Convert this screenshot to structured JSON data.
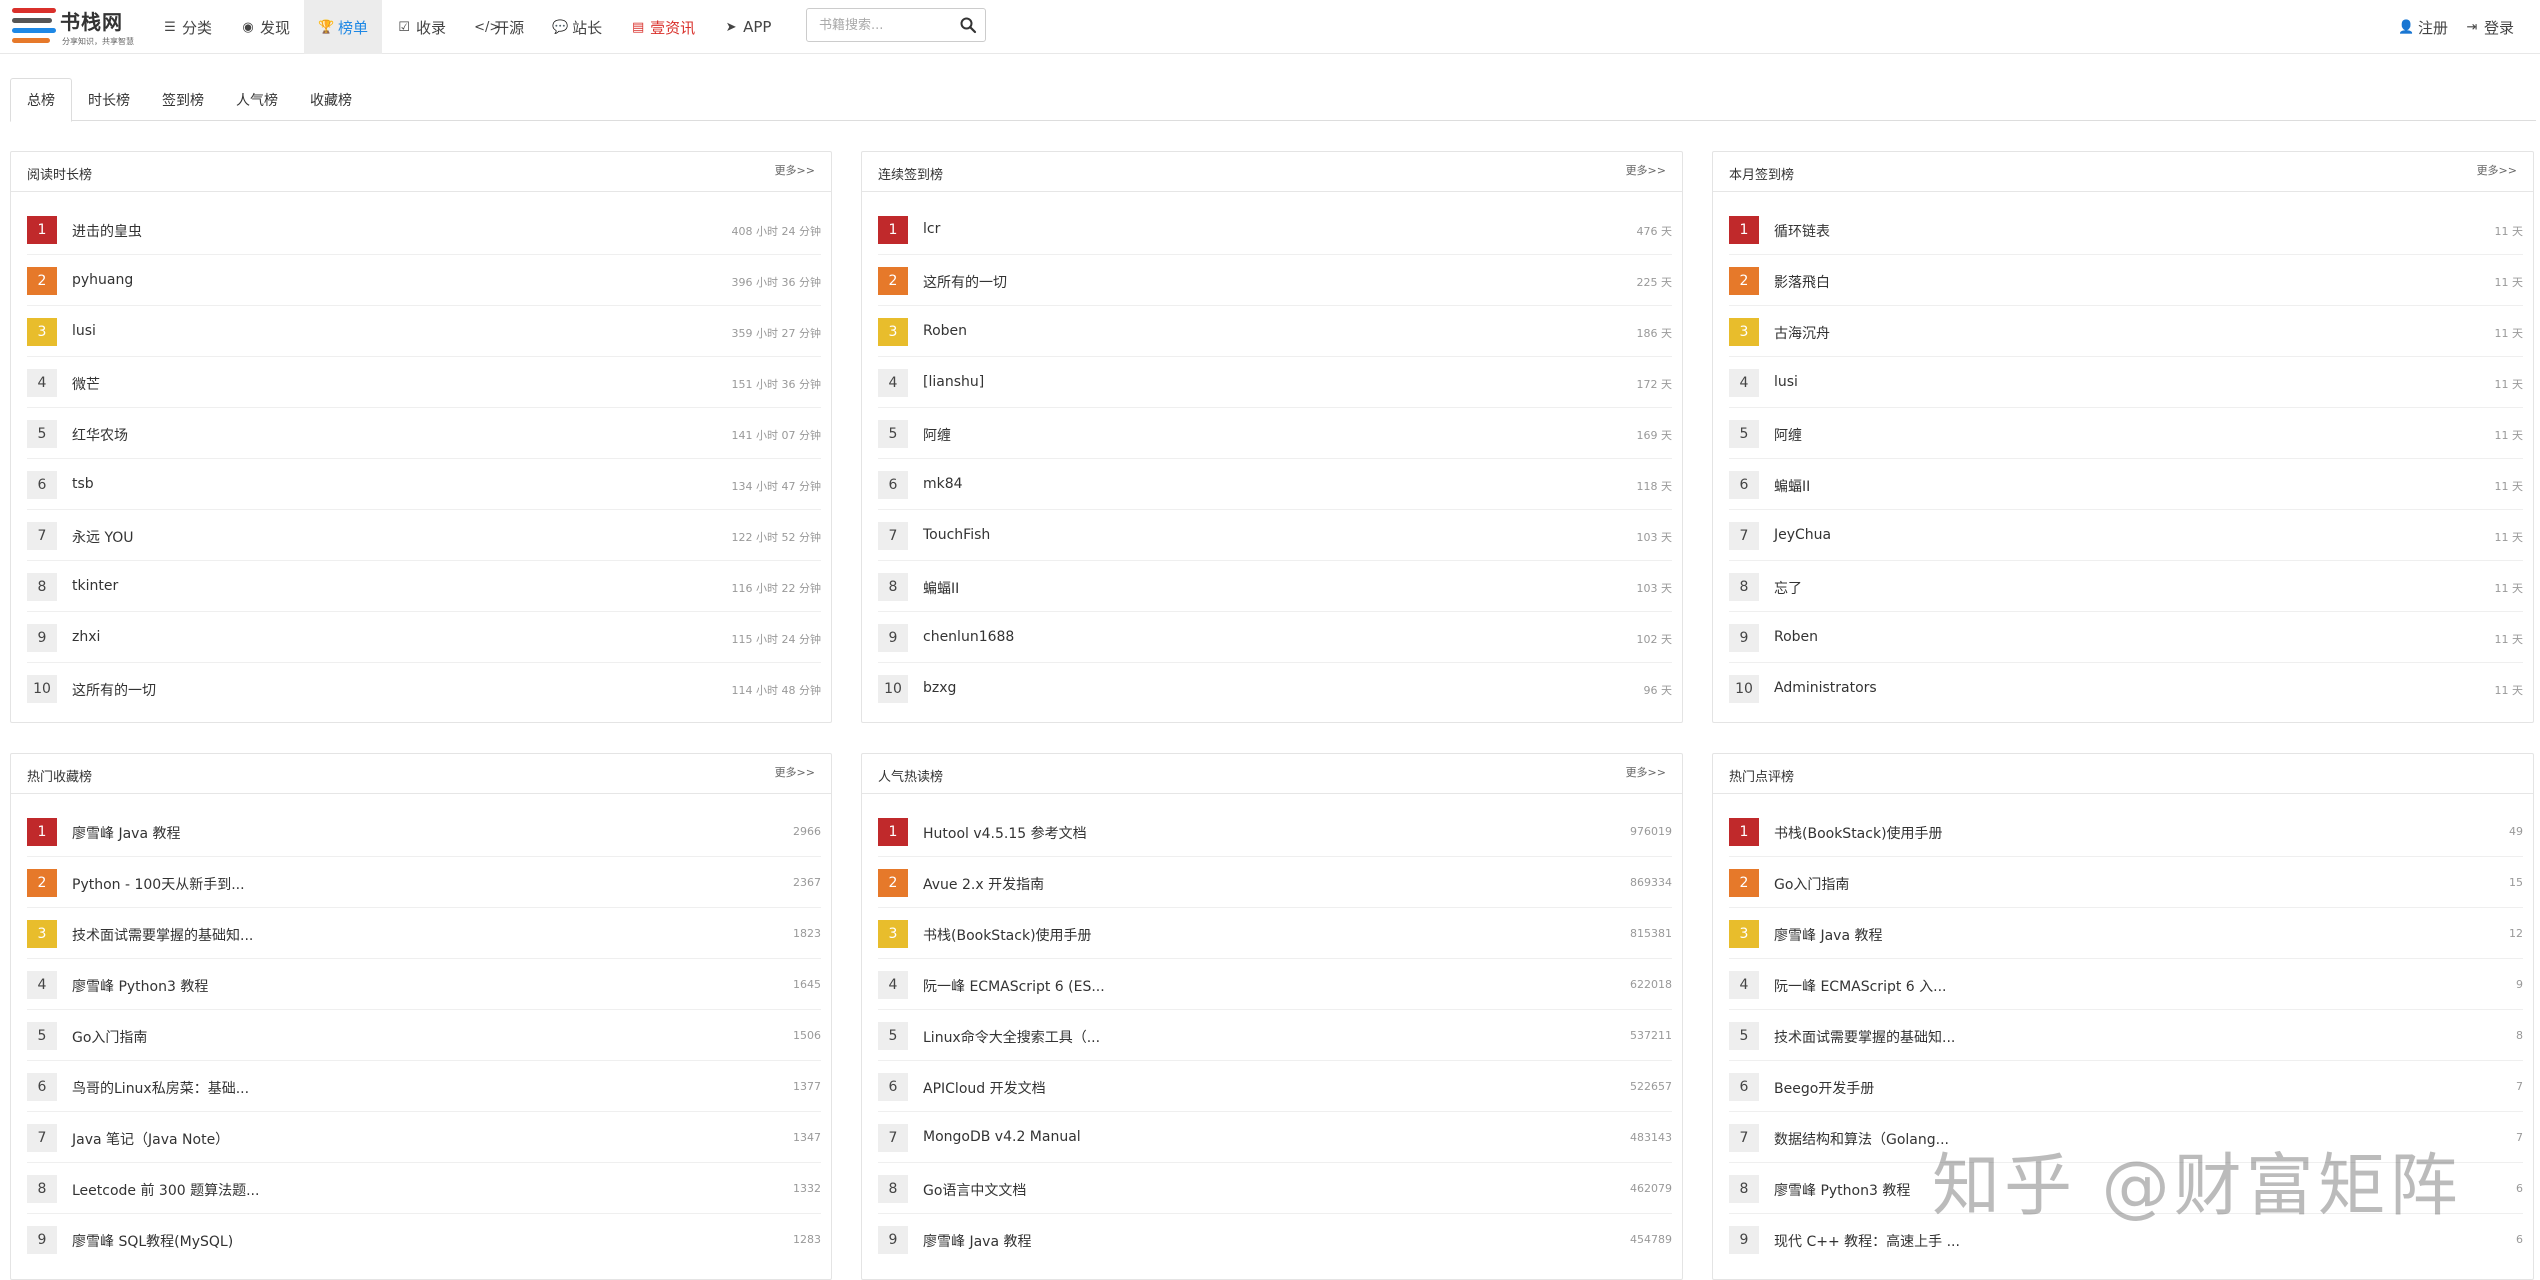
{
  "brand": {
    "title": "书栈网",
    "slogan": "分享知识，共享智慧",
    "colors": [
      "#d9302b",
      "#e6792a",
      "#1e88e5",
      "#555555"
    ]
  },
  "nav": {
    "items": [
      {
        "label": "分类",
        "icon": "list-icon"
      },
      {
        "label": "发现",
        "icon": "globe-icon"
      },
      {
        "label": "榜单",
        "icon": "trophy-icon",
        "active": true
      },
      {
        "label": "收录",
        "icon": "check-square-icon"
      },
      {
        "label": "开源",
        "icon": "code-icon"
      },
      {
        "label": "站长",
        "icon": "wechat-icon"
      },
      {
        "label": "壹资讯",
        "icon": "newspaper-icon",
        "color": "#d9302b"
      },
      {
        "label": "APP",
        "icon": "send-icon"
      }
    ]
  },
  "search": {
    "placeholder": "书籍搜索...",
    "icon": "search-icon"
  },
  "header_right": {
    "register": "注册",
    "login": "登录"
  },
  "tabs": [
    {
      "label": "总榜",
      "active": true
    },
    {
      "label": "时长榜"
    },
    {
      "label": "签到榜"
    },
    {
      "label": "人气榜"
    },
    {
      "label": "收藏榜"
    }
  ],
  "panels": [
    {
      "title": "阅读时长榜",
      "more": "更多>>",
      "rows": [
        {
          "rank": "1",
          "name": "进击的皇虫",
          "value": "408 小时 24 分钟"
        },
        {
          "rank": "2",
          "name": "pyhuang",
          "value": "396 小时 36 分钟"
        },
        {
          "rank": "3",
          "name": "lusi",
          "value": "359 小时 27 分钟"
        },
        {
          "rank": "4",
          "name": "微芒",
          "value": "151 小时 36 分钟"
        },
        {
          "rank": "5",
          "name": "红华农场",
          "value": "141 小时 07 分钟"
        },
        {
          "rank": "6",
          "name": "tsb",
          "value": "134 小时 47 分钟"
        },
        {
          "rank": "7",
          "name": "永远 YOU",
          "value": "122 小时 52 分钟"
        },
        {
          "rank": "8",
          "name": "tkinter",
          "value": "116 小时 22 分钟"
        },
        {
          "rank": "9",
          "name": "zhxi",
          "value": "115 小时 24 分钟"
        },
        {
          "rank": "10",
          "name": "这所有的一切",
          "value": "114 小时 48 分钟"
        }
      ]
    },
    {
      "title": "连续签到榜",
      "more": "更多>>",
      "rows": [
        {
          "rank": "1",
          "name": "lcr",
          "value": "476 天"
        },
        {
          "rank": "2",
          "name": "这所有的一切",
          "value": "225 天"
        },
        {
          "rank": "3",
          "name": "Roben",
          "value": "186 天"
        },
        {
          "rank": "4",
          "name": "[lianshu]",
          "value": "172 天"
        },
        {
          "rank": "5",
          "name": "阿缠",
          "value": "169 天"
        },
        {
          "rank": "6",
          "name": "mk84",
          "value": "118 天"
        },
        {
          "rank": "7",
          "name": "TouchFish",
          "value": "103 天"
        },
        {
          "rank": "8",
          "name": "蝙蝠II",
          "value": "103 天"
        },
        {
          "rank": "9",
          "name": "chenlun1688",
          "value": "102 天"
        },
        {
          "rank": "10",
          "name": "bzxg",
          "value": "96 天"
        }
      ]
    },
    {
      "title": "本月签到榜",
      "more": "更多>>",
      "rows": [
        {
          "rank": "1",
          "name": "循环链表",
          "value": "11 天"
        },
        {
          "rank": "2",
          "name": "影落飛白",
          "value": "11 天"
        },
        {
          "rank": "3",
          "name": "古海沉舟",
          "value": "11 天"
        },
        {
          "rank": "4",
          "name": "lusi",
          "value": "11 天"
        },
        {
          "rank": "5",
          "name": "阿缠",
          "value": "11 天"
        },
        {
          "rank": "6",
          "name": "蝙蝠II",
          "value": "11 天"
        },
        {
          "rank": "7",
          "name": "JeyChua",
          "value": "11 天"
        },
        {
          "rank": "8",
          "name": "忘了",
          "value": "11 天"
        },
        {
          "rank": "9",
          "name": "Roben",
          "value": "11 天"
        },
        {
          "rank": "10",
          "name": "Administrators",
          "value": "11 天"
        }
      ]
    },
    {
      "title": "热门收藏榜",
      "more": "更多>>",
      "rows": [
        {
          "rank": "1",
          "name": "廖雪峰 Java 教程",
          "value": "2966"
        },
        {
          "rank": "2",
          "name": "Python - 100天从新手到...",
          "value": "2367"
        },
        {
          "rank": "3",
          "name": "技术面试需要掌握的基础知...",
          "value": "1823"
        },
        {
          "rank": "4",
          "name": "廖雪峰 Python3 教程",
          "value": "1645"
        },
        {
          "rank": "5",
          "name": "Go入门指南",
          "value": "1506"
        },
        {
          "rank": "6",
          "name": "鸟哥的Linux私房菜：基础...",
          "value": "1377"
        },
        {
          "rank": "7",
          "name": "Java 笔记（Java Note）",
          "value": "1347"
        },
        {
          "rank": "8",
          "name": "Leetcode 前 300 题算法题...",
          "value": "1332"
        },
        {
          "rank": "9",
          "name": "廖雪峰 SQL教程(MySQL)",
          "value": "1283"
        }
      ]
    },
    {
      "title": "人气热读榜",
      "more": "更多>>",
      "rows": [
        {
          "rank": "1",
          "name": "Hutool v4.5.15 参考文档",
          "value": "976019"
        },
        {
          "rank": "2",
          "name": "Avue 2.x 开发指南",
          "value": "869334"
        },
        {
          "rank": "3",
          "name": "书栈(BookStack)使用手册",
          "value": "815381"
        },
        {
          "rank": "4",
          "name": "阮一峰 ECMAScript 6 (ES...",
          "value": "622018"
        },
        {
          "rank": "5",
          "name": "Linux命令大全搜索工具（...",
          "value": "537211"
        },
        {
          "rank": "6",
          "name": "APICloud 开发文档",
          "value": "522657"
        },
        {
          "rank": "7",
          "name": "MongoDB v4.2 Manual",
          "value": "483143"
        },
        {
          "rank": "8",
          "name": "Go语言中文文档",
          "value": "462079"
        },
        {
          "rank": "9",
          "name": "廖雪峰 Java 教程",
          "value": "454789"
        }
      ]
    },
    {
      "title": "热门点评榜",
      "more": "",
      "rows": [
        {
          "rank": "1",
          "name": "书栈(BookStack)使用手册",
          "value": "49"
        },
        {
          "rank": "2",
          "name": "Go入门指南",
          "value": "15"
        },
        {
          "rank": "3",
          "name": "廖雪峰 Java 教程",
          "value": "12"
        },
        {
          "rank": "4",
          "name": "阮一峰 ECMAScript 6 入...",
          "value": "9"
        },
        {
          "rank": "5",
          "name": "技术面试需要掌握的基础知...",
          "value": "8"
        },
        {
          "rank": "6",
          "name": "Beego开发手册",
          "value": "7"
        },
        {
          "rank": "7",
          "name": "数据结构和算法（Golang...",
          "value": "7"
        },
        {
          "rank": "8",
          "name": "廖雪峰 Python3 教程",
          "value": "6"
        },
        {
          "rank": "9",
          "name": "现代 C++ 教程：高速上手 ...",
          "value": "6"
        }
      ]
    }
  ],
  "watermark": "知乎 @财富矩阵"
}
